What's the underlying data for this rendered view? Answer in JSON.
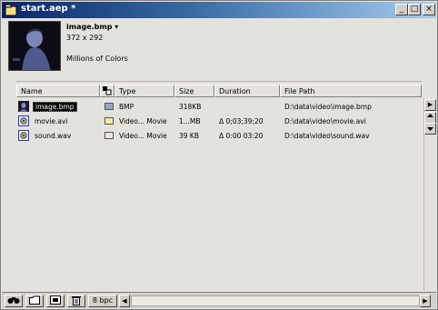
{
  "window": {
    "title": "start.aep *",
    "controls": {
      "minimize": "_",
      "maximize": "□",
      "close": "×"
    }
  },
  "preview": {
    "name": "image.bmp ▾",
    "dimensions": "372 x 292",
    "colors": "Millions of Colors"
  },
  "columns": [
    "Name",
    "Type",
    "Size",
    "Duration",
    "File Path"
  ],
  "label_col_icon": "label-icon",
  "rows": [
    {
      "name": "image.bmp",
      "label_color": "#8fa8d0",
      "type": "BMP",
      "size": "318KB",
      "duration": "",
      "path": "D:\\data\\video\\image.bmp",
      "selected": true,
      "icon": "bmp-file-icon"
    },
    {
      "name": "movie.avi",
      "label_color": "#f0e8a0",
      "type": "Video... Movie",
      "size": "1...MB",
      "duration": "Δ 0;03;39;20",
      "path": "D:\\data\\video\\movie.avi",
      "selected": false,
      "icon": "avi-file-icon"
    },
    {
      "name": "sound.wav",
      "label_color": "#e8e6e0",
      "type": "Video... Movie",
      "size": "39 KB",
      "duration": "Δ 0:00 03:20",
      "path": "D:\\data\\video\\sound.wav",
      "selected": false,
      "icon": "wav-file-icon"
    }
  ],
  "toolbar": {
    "bit_depth": "8 bpc"
  },
  "scroll": {
    "right_arrow": "▶",
    "up_arrow": "◀",
    "left_arrow": "◀",
    "right_end": "▶"
  }
}
